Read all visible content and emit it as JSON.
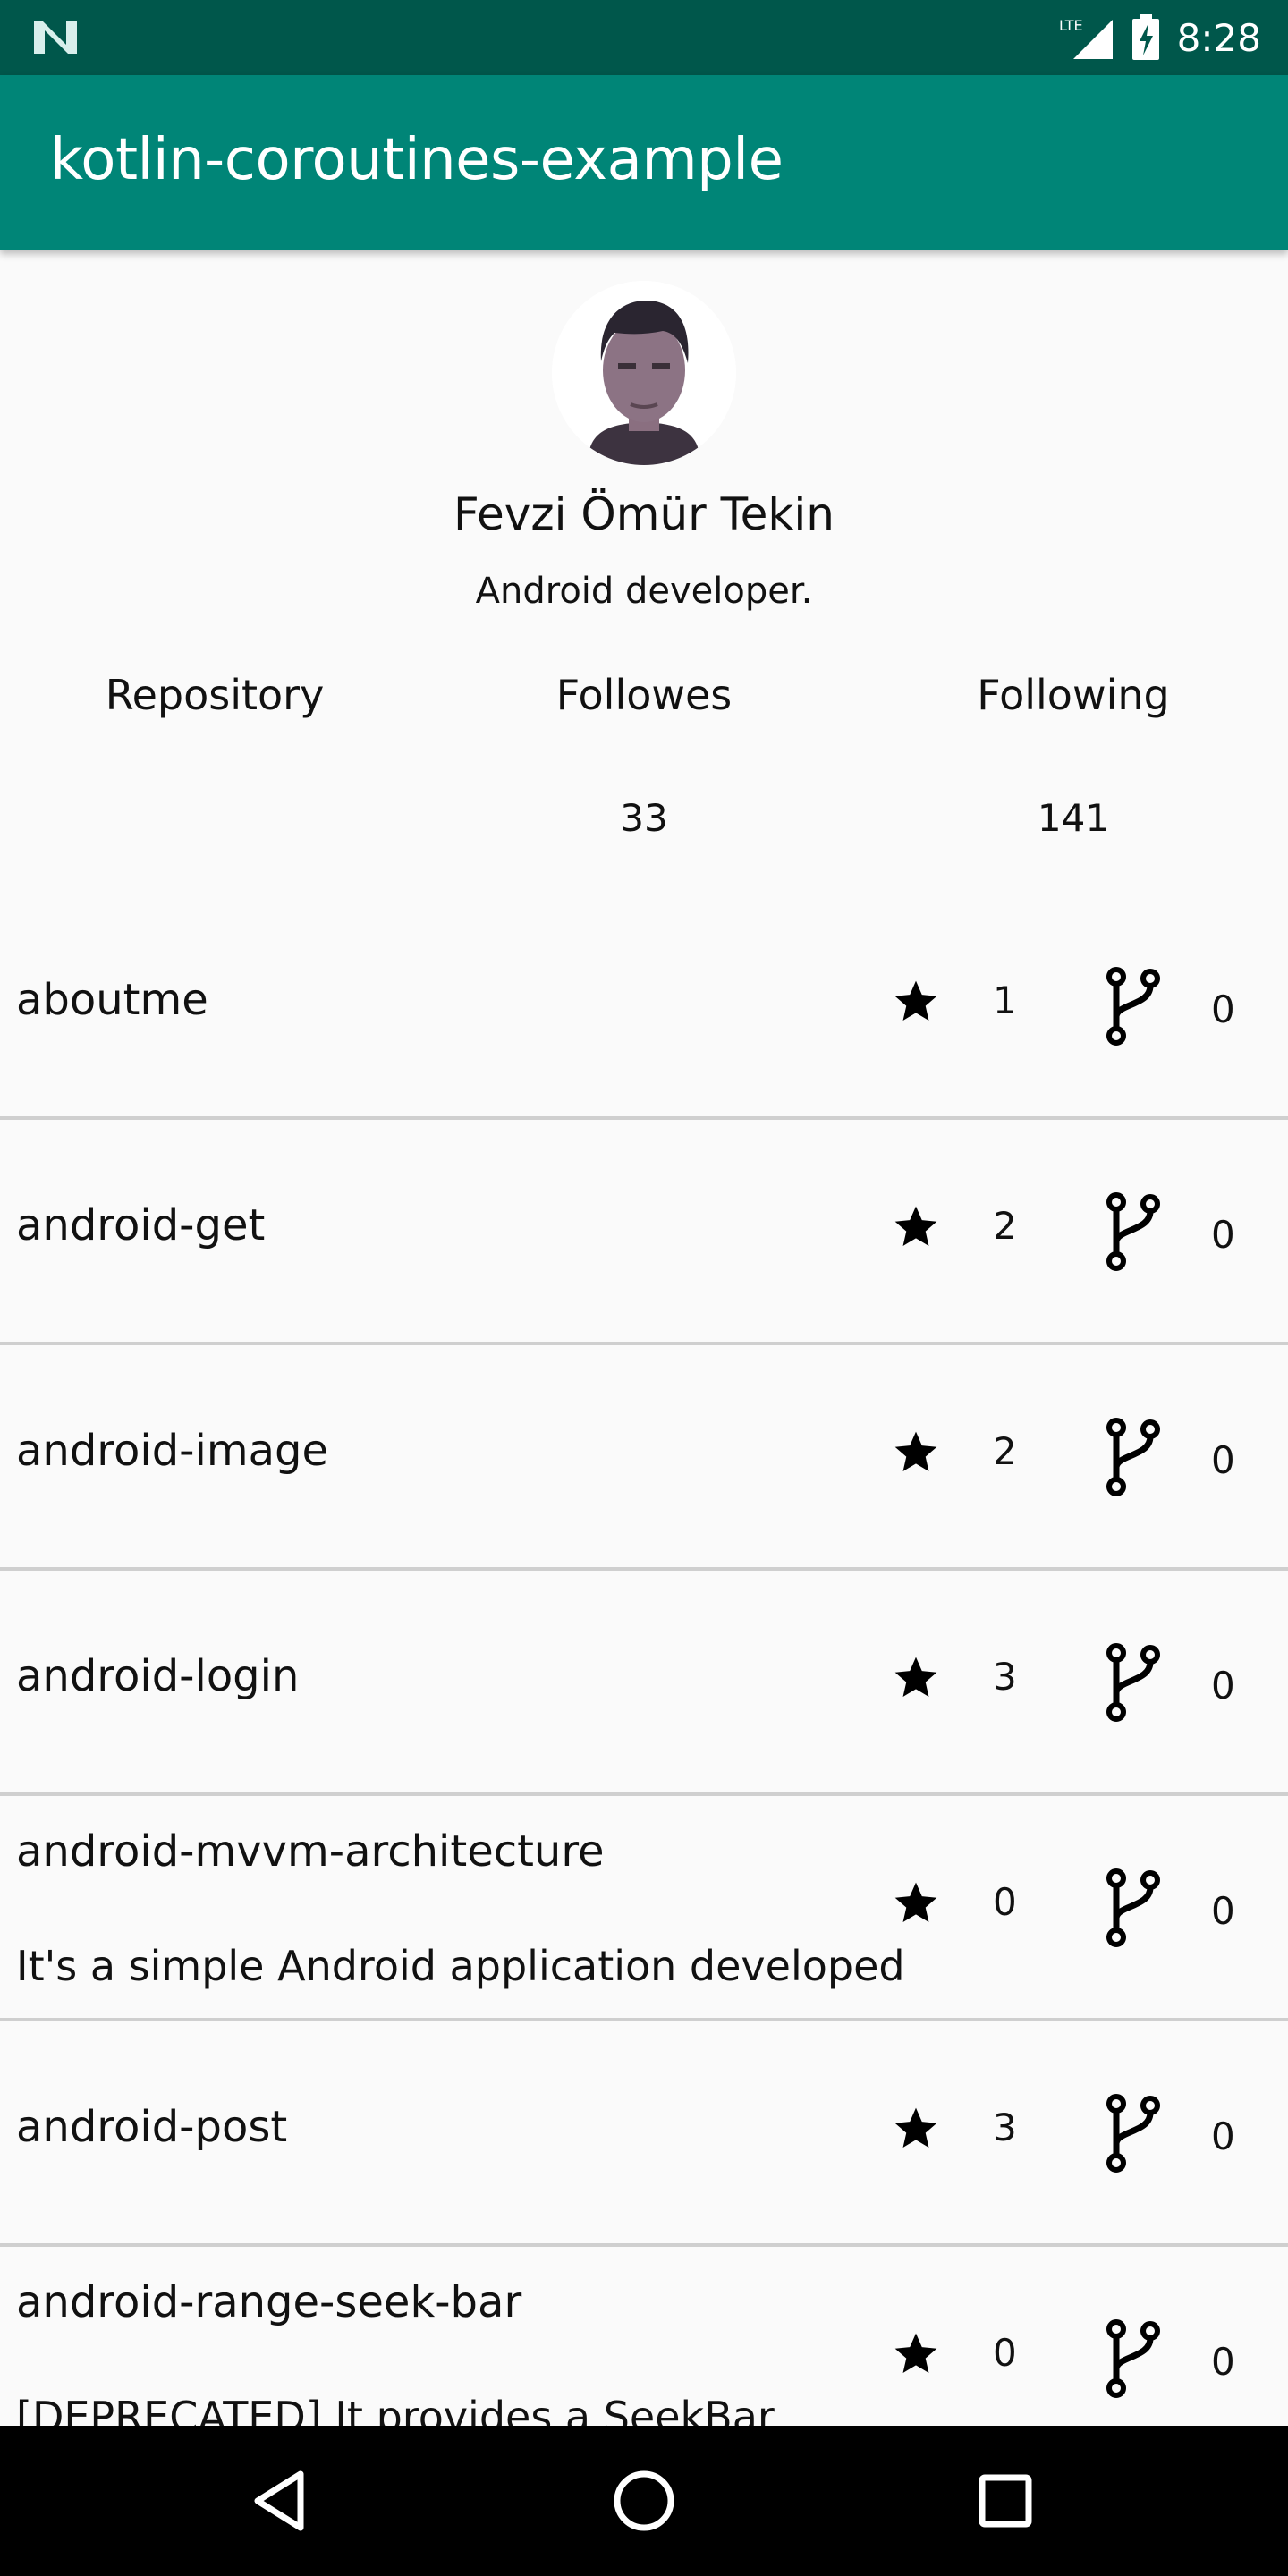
{
  "status_bar": {
    "time": "8:28",
    "network": "LTE",
    "icons": [
      "notification-n-icon",
      "lte-signal-icon",
      "battery-charging-icon"
    ]
  },
  "app_bar": {
    "title": "kotlin-coroutines-example"
  },
  "profile": {
    "name": "Fevzi Ömür Tekin",
    "bio": "Android developer.",
    "stats": [
      {
        "label": "Repository",
        "value": ""
      },
      {
        "label": "Followes",
        "value": "33"
      },
      {
        "label": "Following",
        "value": "141"
      }
    ]
  },
  "repos": [
    {
      "name": "aboutme",
      "description": "",
      "stars": "1",
      "forks": "0"
    },
    {
      "name": "android-get",
      "description": "",
      "stars": "2",
      "forks": "0"
    },
    {
      "name": "android-image",
      "description": "",
      "stars": "2",
      "forks": "0"
    },
    {
      "name": "android-login",
      "description": "",
      "stars": "3",
      "forks": "0"
    },
    {
      "name": "android-mvvm-architecture",
      "description": "It's a simple Android application developed",
      "stars": "0",
      "forks": "0"
    },
    {
      "name": "android-post",
      "description": "",
      "stars": "3",
      "forks": "0"
    },
    {
      "name": "android-range-seek-bar",
      "description": "[DEPRECATED] It provides a SeekBar",
      "stars": "0",
      "forks": "0"
    }
  ],
  "colors": {
    "status_bar": "#00574b",
    "app_bar": "#008577",
    "background": "#fafafa",
    "divider": "#cfcfcf",
    "nav_bar": "#000000"
  }
}
